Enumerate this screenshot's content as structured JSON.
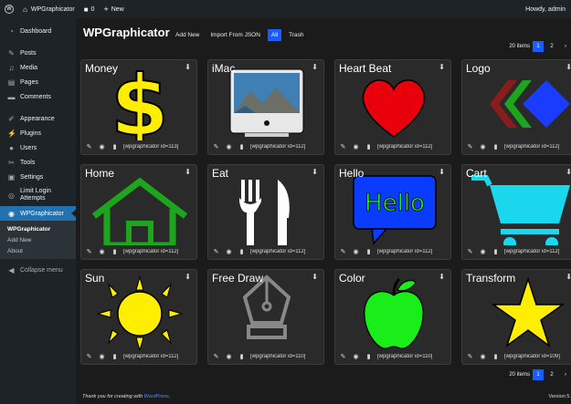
{
  "adminbar": {
    "site_name": "WPGraphicator",
    "comments_count": "0",
    "new_label": "New",
    "howdy": "Howdy, admin"
  },
  "sidebar": {
    "items": [
      {
        "label": "Dashboard",
        "icon": "dashboard-icon"
      },
      {
        "label": "Posts",
        "icon": "pin-icon"
      },
      {
        "label": "Media",
        "icon": "media-icon"
      },
      {
        "label": "Pages",
        "icon": "page-icon"
      },
      {
        "label": "Comments",
        "icon": "comment-icon"
      },
      {
        "label": "Appearance",
        "icon": "brush-icon"
      },
      {
        "label": "Plugins",
        "icon": "plug-icon"
      },
      {
        "label": "Users",
        "icon": "user-icon"
      },
      {
        "label": "Tools",
        "icon": "wrench-icon"
      },
      {
        "label": "Settings",
        "icon": "settings-icon"
      },
      {
        "label": "Limit Login Attempts",
        "icon": "limit-login-icon"
      },
      {
        "label": "WPGraphicator",
        "icon": "wpgraphicator-icon"
      }
    ],
    "submenu": [
      "WPGraphicator",
      "Add New",
      "About"
    ],
    "collapse": "Collapse menu"
  },
  "header": {
    "title": "WPGraphicator",
    "add_new": "Add New",
    "import": "Import From JSON",
    "filter_all": "All",
    "filter_trash": "Trash"
  },
  "pager": {
    "items_label": "20 items",
    "pages": [
      "1",
      "2"
    ],
    "next": "›"
  },
  "cards": [
    {
      "title": "Money",
      "shortcode": "[wpgraphicator id=113]"
    },
    {
      "title": "iMac",
      "shortcode": "[wpgraphicator id=112]"
    },
    {
      "title": "Heart Beat",
      "shortcode": "[wpgraphicator id=112]"
    },
    {
      "title": "Logo",
      "shortcode": "[wpgraphicator id=112]"
    },
    {
      "title": "Home",
      "shortcode": "[wpgraphicator id=112]"
    },
    {
      "title": "Eat",
      "shortcode": "[wpgraphicator id=112]"
    },
    {
      "title": "Hello",
      "shortcode": "[wpgraphicator id=112]",
      "art_text": "Hello"
    },
    {
      "title": "Cart",
      "shortcode": "[wpgraphicator id=112]"
    },
    {
      "title": "Sun",
      "shortcode": "[wpgraphicator id=112]"
    },
    {
      "title": "Free Draw",
      "shortcode": "[wpgraphicator id=110]"
    },
    {
      "title": "Color",
      "shortcode": "[wpgraphicator id=110]"
    },
    {
      "title": "Transform",
      "shortcode": "[wpgraphicator id=109]"
    }
  ],
  "footer": {
    "thanks": "Thank you for creating with",
    "wp_link": "WordPress",
    "version": "Version 5."
  },
  "colors": {
    "accent": "#2271b1",
    "pager_active": "#1a5cff",
    "money": "#ffee00",
    "heart": "#e8000b",
    "home": "#1ea51e",
    "hello_bubble": "#0a3cff",
    "cart": "#1bd7ee",
    "sun": "#ffee00",
    "apple": "#1aee1a",
    "star": "#ffee00"
  }
}
